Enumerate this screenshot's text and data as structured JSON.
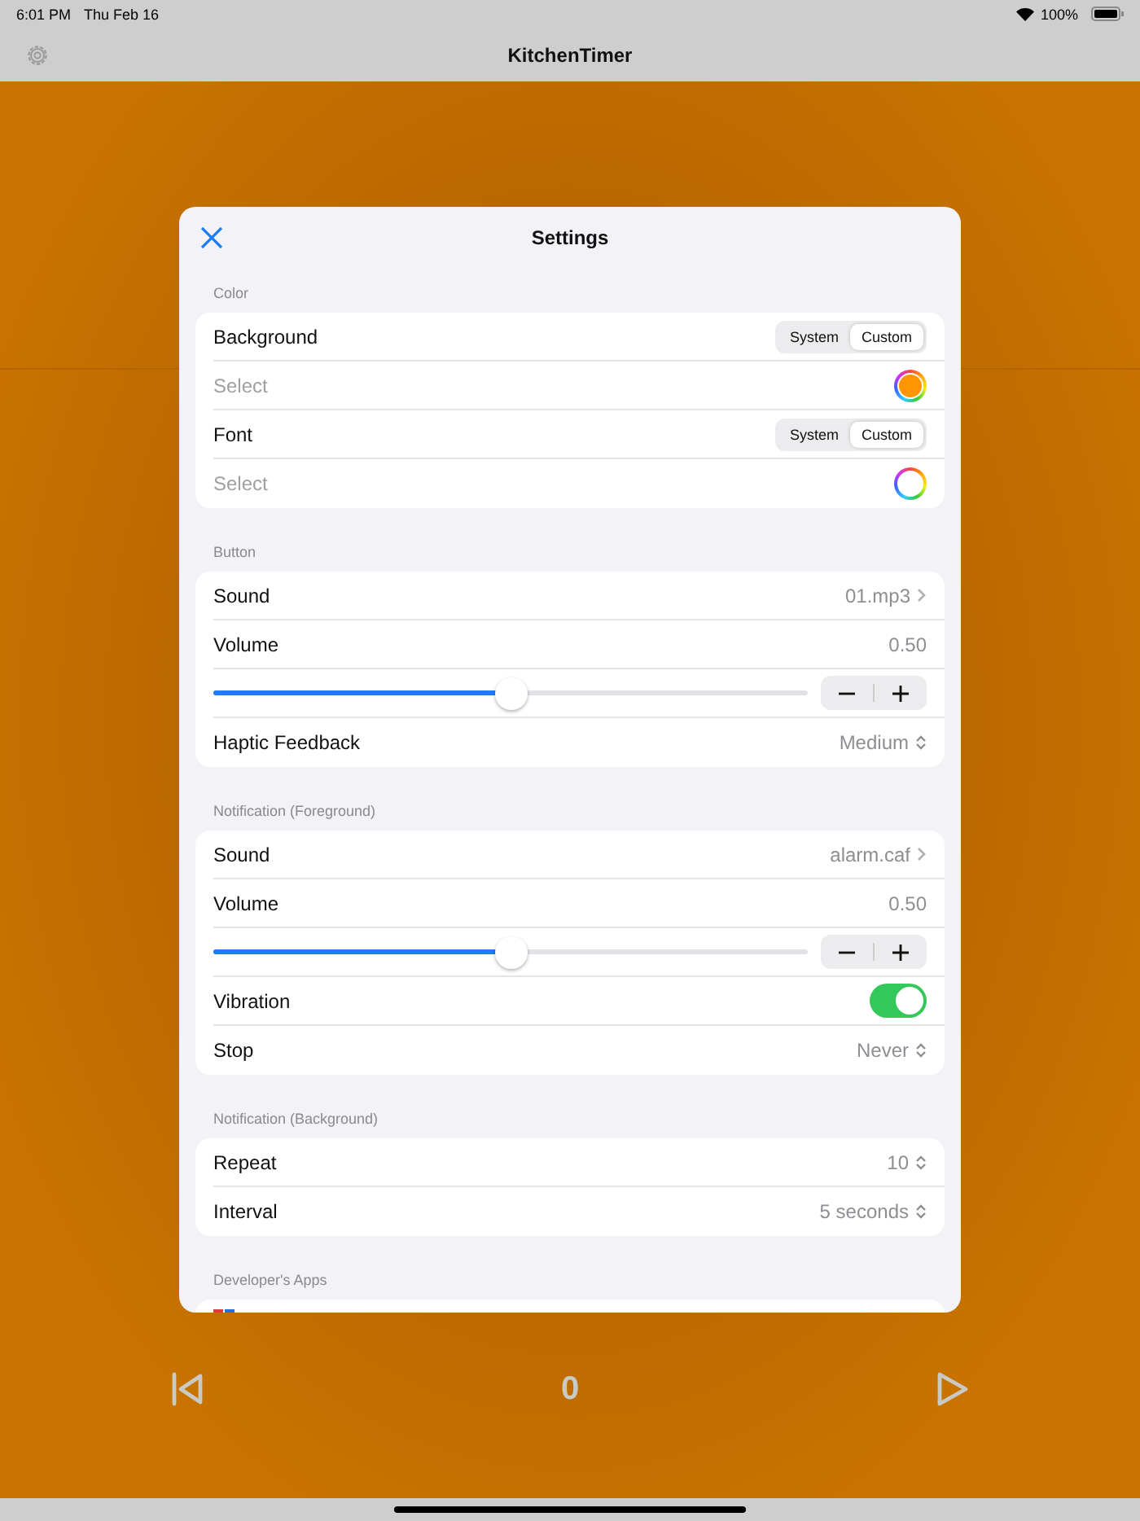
{
  "status_bar": {
    "time": "6:01 PM",
    "date": "Thu Feb 16",
    "battery": "100%"
  },
  "nav_bar": {
    "title": "KitchenTimer"
  },
  "timer": {
    "count": "0"
  },
  "settings": {
    "title": "Settings",
    "sections": [
      {
        "header": "Color",
        "rows": [
          {
            "kind": "segmented",
            "label": "Background",
            "options": [
              {
                "label": "System",
                "selected": false
              },
              {
                "label": "Custom",
                "selected": true
              }
            ]
          },
          {
            "kind": "color",
            "label": "Select",
            "color": "#ff9500"
          },
          {
            "kind": "segmented",
            "label": "Font",
            "options": [
              {
                "label": "System",
                "selected": false
              },
              {
                "label": "Custom",
                "selected": true
              }
            ]
          },
          {
            "kind": "color",
            "label": "Select"
          }
        ]
      },
      {
        "header": "Button",
        "rows": [
          {
            "kind": "link",
            "label": "Sound",
            "value": "01.mp3"
          },
          {
            "kind": "value",
            "label": "Volume",
            "value": "0.50"
          },
          {
            "kind": "slider",
            "level": 0.5
          },
          {
            "kind": "picker",
            "label": "Haptic Feedback",
            "value": "Medium"
          }
        ]
      },
      {
        "header": "Notification (Foreground)",
        "rows": [
          {
            "kind": "link",
            "label": "Sound",
            "value": "alarm.caf"
          },
          {
            "kind": "value",
            "label": "Volume",
            "value": "0.50"
          },
          {
            "kind": "slider",
            "level": 0.5
          },
          {
            "kind": "toggle",
            "label": "Vibration",
            "on": true
          },
          {
            "kind": "picker",
            "label": "Stop",
            "value": "Never"
          }
        ]
      },
      {
        "header": "Notification (Background)",
        "rows": [
          {
            "kind": "picker",
            "label": "Repeat",
            "value": "10"
          },
          {
            "kind": "picker",
            "label": "Interval",
            "value": "5 seconds"
          }
        ]
      },
      {
        "header": "Developer's Apps",
        "rows": [
          {
            "kind": "app"
          }
        ]
      }
    ]
  }
}
